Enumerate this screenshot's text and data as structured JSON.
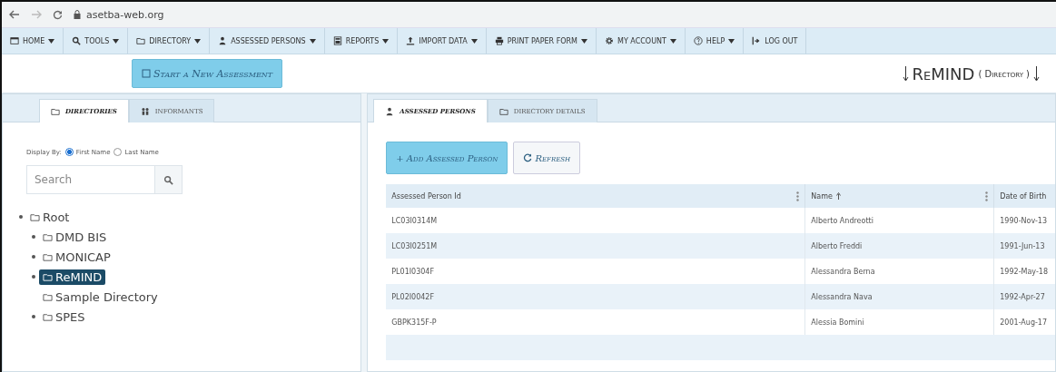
{
  "browser": {
    "url": "asetba-web.org"
  },
  "menu": [
    {
      "label": "HOME",
      "dropdown": true
    },
    {
      "label": "TOOLS",
      "dropdown": true
    },
    {
      "label": "DIRECTORY",
      "dropdown": true
    },
    {
      "label": "ASSESSED PERSONS",
      "dropdown": true
    },
    {
      "label": "REPORTS",
      "dropdown": true
    },
    {
      "label": "IMPORT DATA",
      "dropdown": true
    },
    {
      "label": "PRINT PAPER FORM",
      "dropdown": true
    },
    {
      "label": "MY ACCOUNT",
      "dropdown": true
    },
    {
      "label": "HELP",
      "dropdown": true
    },
    {
      "label": "LOG OUT",
      "dropdown": false
    }
  ],
  "start_button": "Start a New Assessment",
  "heading": {
    "name": "ReMIND",
    "type": "( Directory )"
  },
  "left_tabs": [
    {
      "label": "DIRECTORIES",
      "selected": true
    },
    {
      "label": "INFORMANTS",
      "selected": false
    }
  ],
  "display_by": {
    "label": "Display By:",
    "options": [
      {
        "label": "First Name",
        "selected": true
      },
      {
        "label": "Last Name",
        "selected": false
      }
    ]
  },
  "search": {
    "placeholder": "Search"
  },
  "tree": [
    {
      "label": "Root",
      "expandable": true,
      "selected": false,
      "children": [
        {
          "label": "DMD BIS",
          "expandable": true,
          "selected": false
        },
        {
          "label": "MONICAP",
          "expandable": true,
          "selected": false
        },
        {
          "label": "ReMIND",
          "expandable": true,
          "selected": true
        },
        {
          "label": "Sample Directory",
          "expandable": false,
          "selected": false
        },
        {
          "label": "SPES",
          "expandable": true,
          "selected": false
        }
      ]
    }
  ],
  "right_tabs": [
    {
      "label": "ASSESSED PERSONS",
      "selected": true
    },
    {
      "label": "DIRECTORY DETAILS",
      "selected": false
    }
  ],
  "actions": [
    {
      "kind": "primary",
      "label": "+ Add Assessed Person"
    },
    {
      "kind": "refresh",
      "label": "Refresh"
    }
  ],
  "table": {
    "columns": [
      {
        "label": "Assessed Person Id",
        "sorted": false,
        "menu": true
      },
      {
        "label": "Name",
        "sorted": true,
        "menu": true
      },
      {
        "label": "Date of Birth",
        "sorted": false,
        "menu": false
      }
    ],
    "rows": [
      [
        "LC03I0314M",
        "Alberto Andreotti",
        "1990-Nov-13"
      ],
      [
        "LC03I0251M",
        "Alberto Freddi",
        "1991-Jun-13"
      ],
      [
        "PL01I0304F",
        "Alessandra Berna",
        "1992-May-18"
      ],
      [
        "PL02I0042F",
        "Alessandra Nava",
        "1992-Apr-27"
      ],
      [
        "GBPK315F-P",
        "Alessia Bomini",
        "2001-Aug-17"
      ]
    ]
  }
}
